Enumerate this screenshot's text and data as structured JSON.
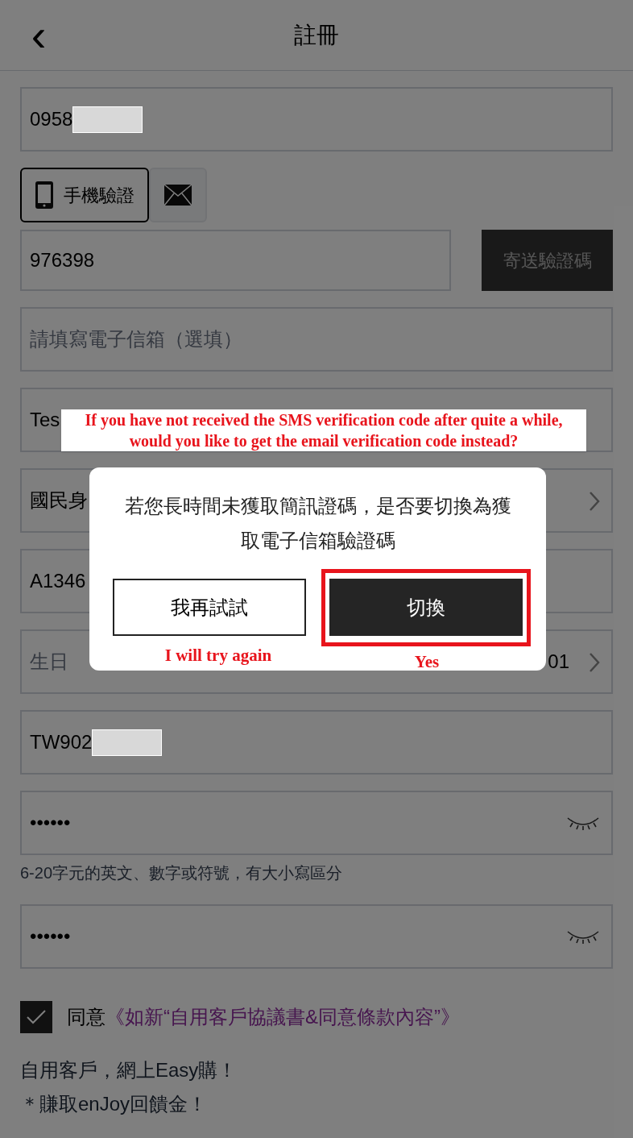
{
  "header": {
    "back_icon": "‹",
    "title": "註冊"
  },
  "phone_field": {
    "value": "0958",
    "redacted": true
  },
  "verify_methods": [
    {
      "kind": "phone",
      "label": "手機驗證",
      "selected": true
    },
    {
      "kind": "email",
      "selected": false
    }
  ],
  "code_row": {
    "value": "976398",
    "button": "寄送驗證碼"
  },
  "fields": [
    {
      "kind": "input",
      "placeholder": "請填寫電子信箱（選填）"
    },
    {
      "kind": "input",
      "value": "Tes"
    },
    {
      "kind": "select",
      "value": "國民身"
    },
    {
      "kind": "input",
      "value": "A1346"
    },
    {
      "kind": "select",
      "placeholder": "生日",
      "value": "01"
    },
    {
      "kind": "input",
      "value": "TW902",
      "redacted": true
    },
    {
      "kind": "password",
      "value": "••••••"
    },
    {
      "kind": "hint",
      "text": "6-20字元的英文、數字或符號，有大小寫區分"
    },
    {
      "kind": "password",
      "value": "••••••"
    }
  ],
  "agreement": {
    "checked": true,
    "label": "同意",
    "link": "《如新“自用客戶協議書&同意條款內容”》"
  },
  "promo_lines": [
    "自用客戶，網上Easy購！",
    "＊賺取enJoy回饋金！"
  ],
  "dialog": {
    "message": "若您長時間未獲取簡訊證碼，是否要切換為獲取電子信箱驗證碼",
    "buttons": [
      {
        "kind": "outline",
        "label": "我再試試",
        "highlighted": false
      },
      {
        "kind": "solid",
        "label": "切換",
        "highlighted": true
      }
    ]
  },
  "annotations": [
    {
      "kind": "callout",
      "text": "If you have not received the SMS verification code after quite a while, would you like to get the email verification code instead?"
    },
    {
      "kind": "label",
      "text": "I will try again"
    },
    {
      "kind": "label",
      "text": "Yes"
    }
  ]
}
